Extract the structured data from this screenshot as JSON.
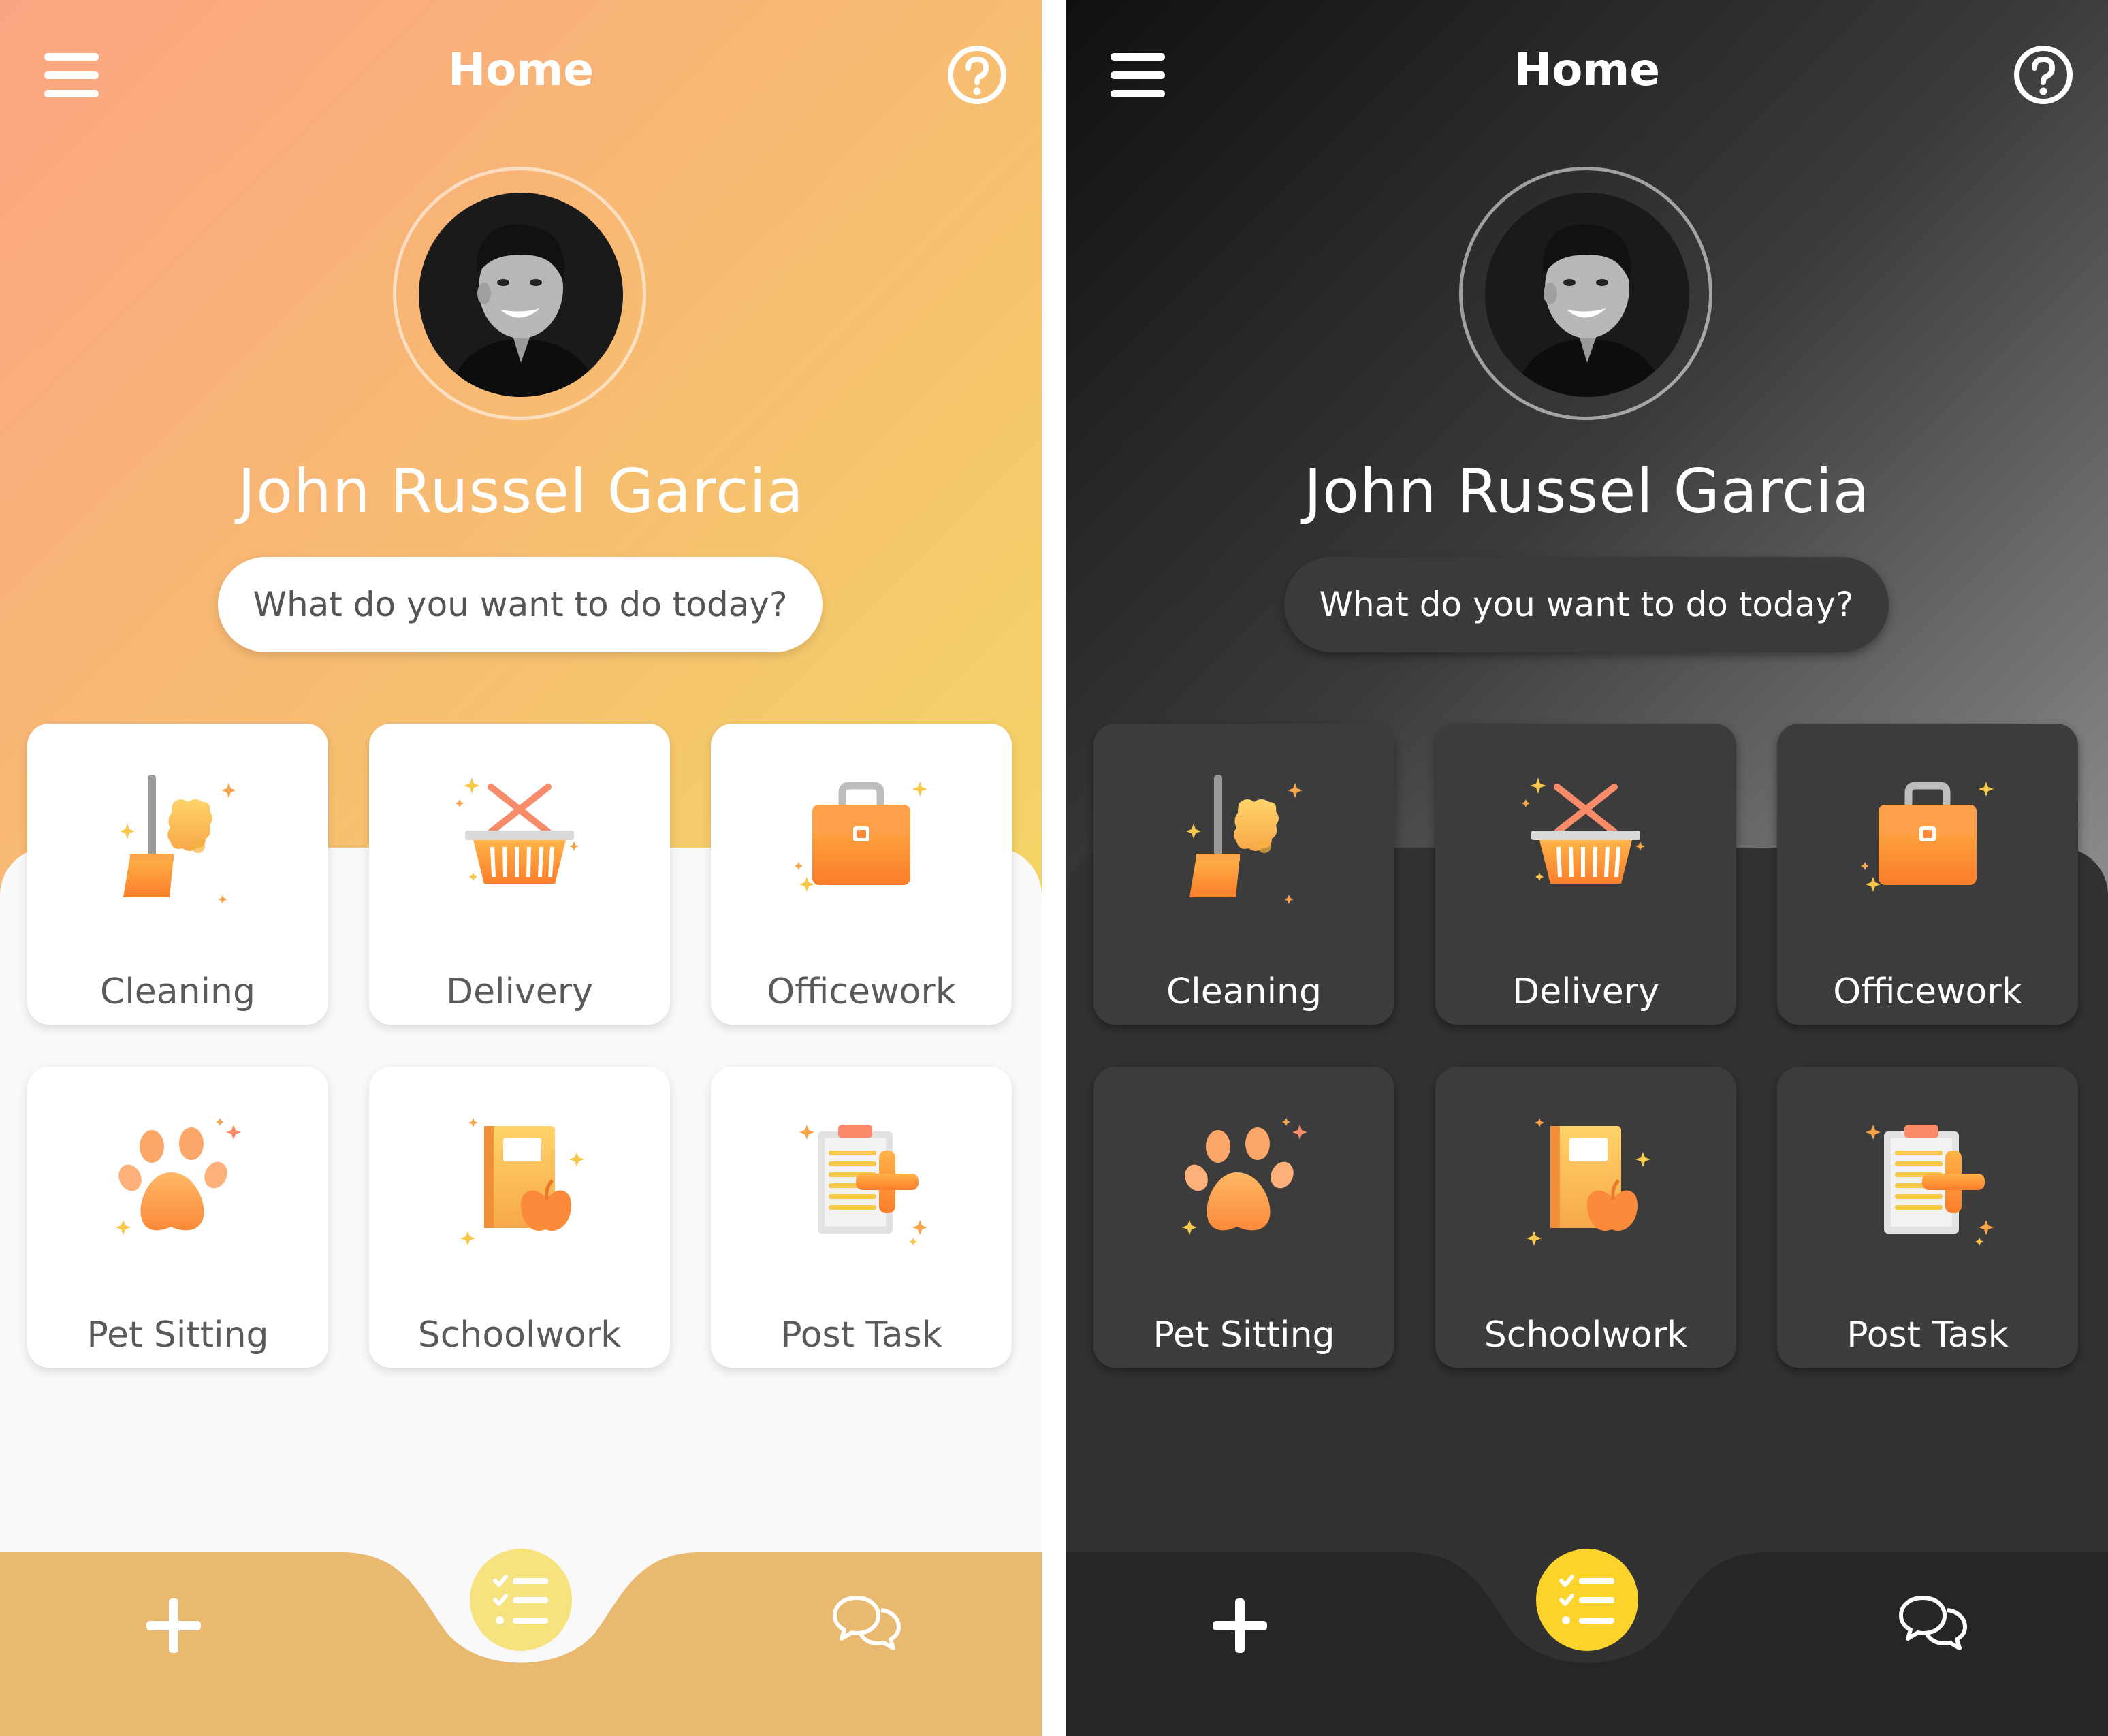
{
  "screens": [
    {
      "theme": "light",
      "title": "Home",
      "user_name": "John Russel Garcia",
      "prompt": "What do you want to do today?",
      "categories": [
        {
          "label": "Cleaning",
          "icon": "broom-sponge-icon"
        },
        {
          "label": "Delivery",
          "icon": "basket-icon"
        },
        {
          "label": "Officework",
          "icon": "briefcase-icon"
        },
        {
          "label": "Pet Sitting",
          "icon": "paw-icon"
        },
        {
          "label": "Schoolwork",
          "icon": "book-apple-icon"
        },
        {
          "label": "Post Task",
          "icon": "clipboard-plus-icon"
        }
      ],
      "nav": {
        "left": "plus-icon",
        "center": "task-list-icon",
        "right": "chat-icon"
      },
      "colors": {
        "background_gradient": [
          "#fba482",
          "#f4d566"
        ],
        "surface": "#f9f9f9",
        "nav_bar": "#e8b96f",
        "accent": "#f6e27f"
      }
    },
    {
      "theme": "dark",
      "title": "Home",
      "user_name": "John Russel Garcia",
      "prompt": "What do you want to do today?",
      "categories": [
        {
          "label": "Cleaning",
          "icon": "broom-sponge-icon"
        },
        {
          "label": "Delivery",
          "icon": "basket-icon"
        },
        {
          "label": "Officework",
          "icon": "briefcase-icon"
        },
        {
          "label": "Pet Sitting",
          "icon": "paw-icon"
        },
        {
          "label": "Schoolwork",
          "icon": "book-apple-icon"
        },
        {
          "label": "Post Task",
          "icon": "clipboard-plus-icon"
        }
      ],
      "nav": {
        "left": "plus-icon",
        "center": "task-list-icon",
        "right": "chat-icon"
      },
      "colors": {
        "background_gradient": [
          "#101010",
          "#8f8f8f"
        ],
        "surface": "#323232",
        "nav_bar": "#262626",
        "accent": "#fcd32a"
      }
    }
  ]
}
